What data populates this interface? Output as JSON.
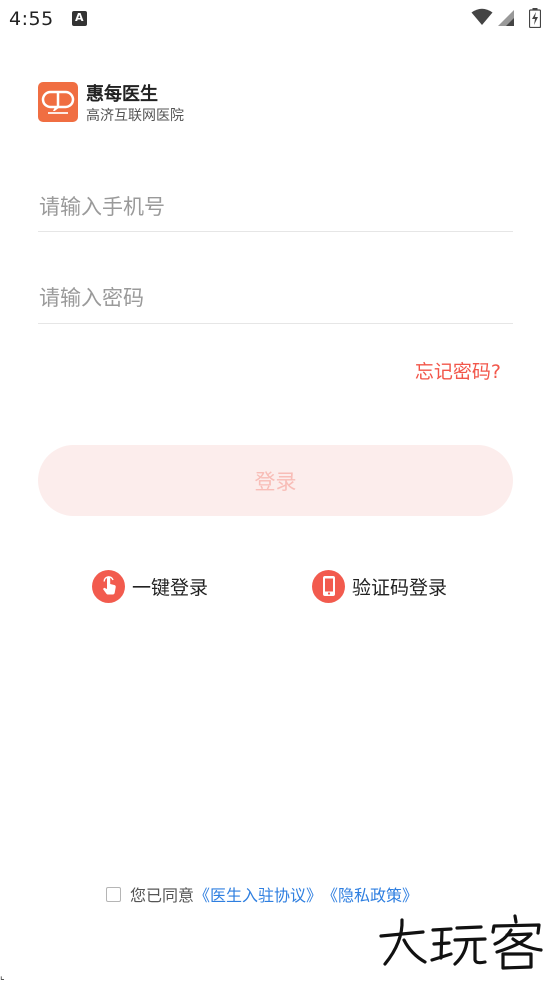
{
  "status_bar": {
    "time": "4:55",
    "notification_icon": "keyboard-a-icon",
    "icons": [
      "wifi-icon",
      "signal-icon",
      "battery-charging-icon"
    ]
  },
  "brand": {
    "logo_icon": "speech-bubble-logo",
    "name": "惠每医生",
    "subtitle": "高济互联网医院"
  },
  "form": {
    "phone_placeholder": "请输入手机号",
    "phone_value": "",
    "password_placeholder": "请输入密码",
    "password_value": "",
    "forgot_password": "忘记密码?",
    "login_button": "登录"
  },
  "alt_login": {
    "one_click_label": "一键登录",
    "one_click_icon": "tap-hand-icon",
    "sms_label": "验证码登录",
    "sms_icon": "phone-icon"
  },
  "agreement": {
    "checked": false,
    "prefix": "您已同意",
    "doctor_agreement": "《医生入驻协议》",
    "privacy_policy": "《隐私政策》"
  },
  "watermark": {
    "text": "大玩客"
  },
  "colors": {
    "accent": "#f2564a",
    "logo": "#f06e42",
    "button_bg": "#fcedec",
    "link": "#2f7fe0"
  }
}
